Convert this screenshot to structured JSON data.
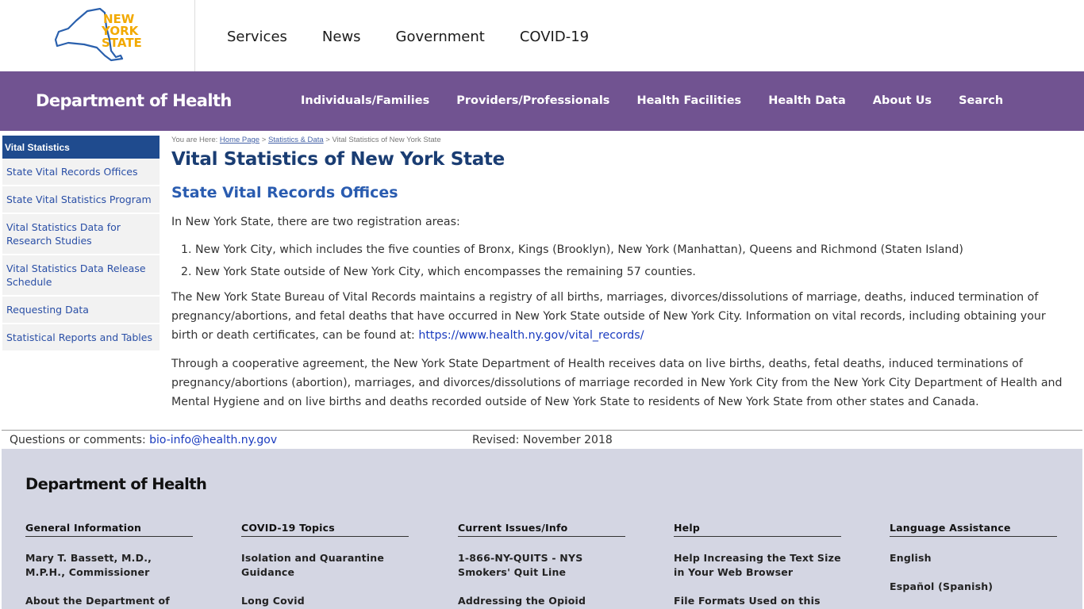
{
  "logo": {
    "line1": "NEW",
    "line2": "YORK",
    "line3": "STATE",
    "color": "#f2a900",
    "outline_color": "#2a60ad"
  },
  "topnav": [
    "Services",
    "News",
    "Government",
    "COVID-19"
  ],
  "doh": {
    "title": "Department of Health",
    "bar_color": "#715391",
    "nav": [
      "Individuals/Families",
      "Providers/Professionals",
      "Health Facilities",
      "Health Data",
      "About Us",
      "Search"
    ]
  },
  "sidebar": {
    "header": "Vital Statistics",
    "items": [
      "State Vital Records Offices",
      "State Vital Statistics Program",
      "Vital Statistics Data for Research Studies",
      "Vital Statistics Data Release Schedule",
      "Requesting Data",
      "Statistical Reports and Tables"
    ]
  },
  "breadcrumb": {
    "prefix": "You are Here:",
    "home": "Home Page",
    "sep1": ">",
    "stats": "Statistics & Data",
    "sep2": ">",
    "current": "Vital Statistics of New York State"
  },
  "main": {
    "title": "Vital Statistics of New York State",
    "section": "State Vital Records Offices",
    "intro": "In New York State, there are two registration areas:",
    "list": [
      "New York City, which includes the five counties of Bronx, Kings (Brooklyn), New York (Manhattan), Queens and Richmond (Staten Island)",
      "New York State outside of New York City, which encompasses the remaining 57 counties."
    ],
    "para2": "The New York State Bureau of Vital Records maintains a registry of all births, marriages, divorces/dissolutions of marriage, deaths, induced termination of pregnancy/abortions, and fetal deaths that have occurred in New York State outside of New York City. Information on vital records, including obtaining your birth or death certificates, can be found at: ",
    "para2_link": "https://www.health.ny.gov/vital_records/",
    "para3": "Through a cooperative agreement, the New York State Department of Health receives data on live births, deaths, fetal deaths, induced terminations of pregnancy/abortions (abortion), marriages, and divorces/dissolutions of marriage recorded in New York City from the New York City Department of Health and Mental Hygiene and on live births and deaths recorded outside of New York State to residents of New York State from other states and Canada."
  },
  "questions": {
    "label": "Questions or comments: ",
    "email": "bio-info@health.ny.gov",
    "revised": "Revised: November 2018"
  },
  "footer": {
    "title": "Department of Health",
    "bg_color": "#d4d6e3",
    "columns": [
      {
        "heading": "General Information",
        "links": [
          "Mary T. Bassett, M.D., M.P.H., Commissioner",
          "About the Department of"
        ]
      },
      {
        "heading": "COVID-19 Topics",
        "links": [
          "Isolation and Quarantine Guidance",
          "Long Covid"
        ]
      },
      {
        "heading": "Current Issues/Info",
        "links": [
          "1-866-NY-QUITS - NYS Smokers' Quit Line",
          "Addressing the Opioid"
        ]
      },
      {
        "heading": "Help",
        "links": [
          "Help Increasing the Text Size in Your Web Browser",
          "File Formats Used on this Web"
        ]
      },
      {
        "heading": "Language Assistance",
        "links": [
          "English",
          "Español (Spanish)"
        ]
      }
    ]
  }
}
